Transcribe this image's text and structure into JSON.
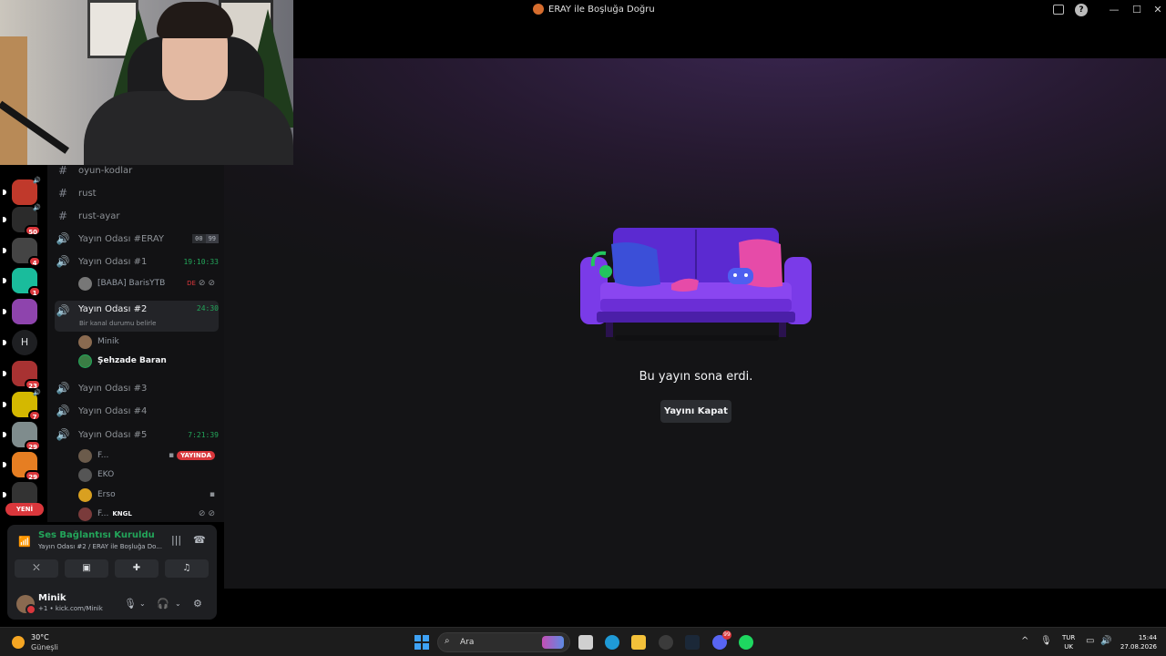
{
  "window": {
    "title": "ERAY ile Boşluğa Doğru",
    "controls": {
      "minimize": "—",
      "maximize": "☐",
      "close": "✕",
      "help": "?"
    }
  },
  "stream": {
    "ended_message": "Bu yayın sona erdi.",
    "close_button": "Yayını Kapat",
    "illustration": "couch-icon"
  },
  "servers": {
    "items": [
      {
        "icon": "server-icon",
        "color": "#c0392b",
        "speaker": true,
        "badge": ""
      },
      {
        "icon": "server-icon",
        "color": "#2b2b2b",
        "speaker": true,
        "badge": "50"
      },
      {
        "icon": "server-icon",
        "color": "#444444",
        "speaker": false,
        "badge": "4"
      },
      {
        "icon": "server-icon",
        "color": "#1abc9c",
        "speaker": false,
        "badge": "1"
      },
      {
        "icon": "server-icon",
        "color": "#8e44ad",
        "speaker": false,
        "badge": ""
      },
      {
        "icon": "server-letter",
        "letter": "H",
        "badge": ""
      },
      {
        "icon": "server-icon",
        "color": "#a83232",
        "speaker": false,
        "badge": "23"
      },
      {
        "icon": "server-icon",
        "color": "#d4b800",
        "speaker": true,
        "badge": "7"
      },
      {
        "icon": "server-icon",
        "color": "#7f8c8d",
        "speaker": false,
        "badge": "29"
      },
      {
        "icon": "server-icon",
        "color": "#e67e22",
        "speaker": false,
        "badge": "29"
      },
      {
        "icon": "server-icon",
        "color": "#333333",
        "speaker": false,
        "badge": ""
      }
    ],
    "new_label": "YENİ"
  },
  "channels": {
    "text": [
      {
        "name": "oyun-kodlar"
      },
      {
        "name": "rust"
      },
      {
        "name": "rust-ayar"
      }
    ],
    "voice": [
      {
        "name": "Yayın Odası #ERAY",
        "counts": [
          "00",
          "99"
        ]
      },
      {
        "name": "Yayın Odası #1",
        "timer": "19:10:33",
        "users": [
          {
            "name": "[BABA] BarisYTB",
            "tag": "DE"
          }
        ]
      },
      {
        "name": "Yayın Odası #2",
        "timer": "24:30",
        "status": "Bir kanal durumu belirle",
        "users": [
          {
            "name": "Minik"
          },
          {
            "name": "Şehzade Baran"
          }
        ]
      },
      {
        "name": "Yayın Odası #3"
      },
      {
        "name": "Yayın Odası #4"
      },
      {
        "name": "Yayın Odası #5",
        "timer": "7:21:39",
        "users": [
          {
            "name": "F...",
            "live": "YAYINDA"
          },
          {
            "name": "EKO"
          },
          {
            "name": "Erso"
          },
          {
            "name": "F...",
            "tag": "KNGL"
          }
        ]
      }
    ]
  },
  "voice_panel": {
    "title": "Ses Bağlantısı Kuruldu",
    "subtitle": "Yayın Odası #2 / ERAY ile Boşluğa Do...",
    "buttons": [
      "camera-off-icon",
      "screen-share-icon",
      "activities-icon",
      "soundboard-icon"
    ]
  },
  "user_panel": {
    "name": "Minik",
    "status": "+1 • kick.com/Minik"
  },
  "taskbar": {
    "weather_temp": "30°C",
    "weather_desc": "Güneşli",
    "search_label": "Ara",
    "apps": [
      {
        "icon": "task-view-icon",
        "color": "#d0d0d0",
        "badge": ""
      },
      {
        "icon": "edge-icon",
        "color": "#1f9ad6",
        "badge": ""
      },
      {
        "icon": "folder-icon",
        "color": "#f3c13a",
        "badge": ""
      },
      {
        "icon": "obs-icon",
        "color": "#3b3b3b",
        "badge": ""
      },
      {
        "icon": "steam-icon",
        "color": "#1b2838",
        "badge": ""
      },
      {
        "icon": "discord-icon",
        "color": "#5865f2",
        "badge": "99"
      },
      {
        "icon": "spotify-icon",
        "color": "#1ed760",
        "badge": ""
      }
    ],
    "lang_top": "TUR",
    "lang_bottom": "UK",
    "time": "15:44",
    "date": "27.08.2026"
  }
}
